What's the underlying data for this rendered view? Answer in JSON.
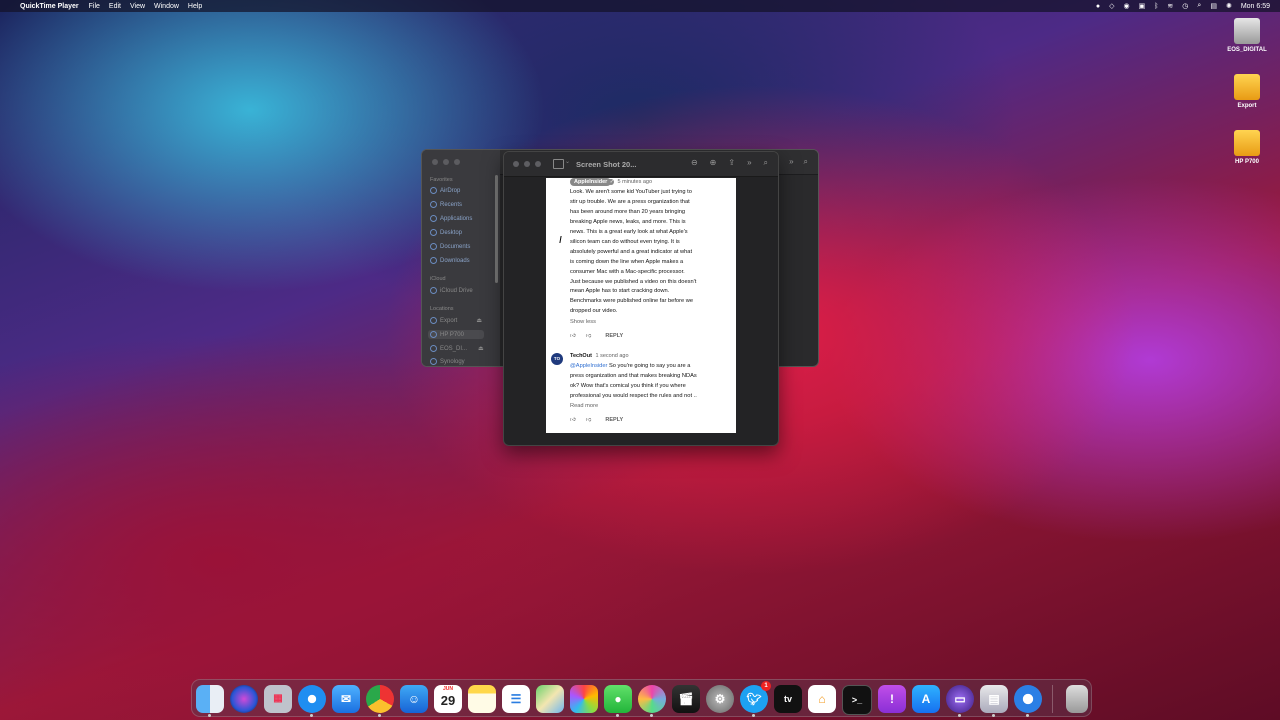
{
  "menubar": {
    "app": "QuickTime Player",
    "items": [
      "File",
      "Edit",
      "View",
      "Window",
      "Help"
    ],
    "clock": "Mon 6:59"
  },
  "desktop_drives": [
    {
      "label": "EOS_DIGITAL",
      "color": "gray"
    },
    {
      "label": "Export",
      "color": "gold"
    },
    {
      "label": "HP P700",
      "color": "gold"
    }
  ],
  "finder": {
    "section_favorites": "Favorites",
    "favorites": [
      "AirDrop",
      "Recents",
      "Applications",
      "Desktop",
      "Documents",
      "Downloads"
    ],
    "section_icloud": "iCloud",
    "icloud": [
      "iCloud Drive"
    ],
    "section_locations": "Locations",
    "locations": [
      "Export",
      "HP P700",
      "EOS_DI...",
      "Synology"
    ]
  },
  "preview": {
    "title": "Screen Shot 20...",
    "comment1": {
      "author": "AppleInsider",
      "time": "5 minutes ago",
      "lines": [
        "Look. We aren't some kid YouTuber just trying to",
        "stir up trouble. We are a press organization that",
        "has been around more than 20 years bringing",
        "breaking Apple news, leaks, and more. This is",
        "news. This is a great early look at what Apple's",
        "silicon team can do without even trying. It is",
        "absolutely powerful and a great indicator at what",
        "is coming down the line when Apple makes a",
        "consumer Mac with a Mac-specific processor.",
        "Just because we published a video on this doesn't",
        "mean Apple has to start cracking down.",
        "Benchmarks were published online far before we",
        "dropped our video."
      ],
      "toggle": "Show less",
      "reply": "REPLY"
    },
    "comment2": {
      "avatar": "TO",
      "author": "TechOut",
      "time": "1 second ago",
      "mention": "@AppleInsider",
      "first_line": " So you're going to say you are a",
      "lines": [
        "press organization and that makes breaking NDAs",
        "ok? Wow that's comical you think if you where",
        "professional you would respect the rules and not .."
      ],
      "toggle": "Read more",
      "reply": "REPLY"
    }
  },
  "dock": {
    "calendar_month": "JUN",
    "calendar_day": "29",
    "twitter_badge": "1",
    "apps": [
      "finder-icon",
      "siri-icon",
      "launchpad-icon",
      "safari-icon",
      "mail-icon",
      "chrome-icon",
      "migration-icon",
      "calendar-icon",
      "notes-icon",
      "reminders-icon",
      "maps-icon",
      "photos-icon",
      "messages-icon",
      "motion-icon",
      "final-cut-icon",
      "settings-icon",
      "twitter-icon",
      "apple-tv-icon",
      "home-icon",
      "terminal-icon",
      "feedback-icon",
      "app-store-icon",
      "disk-icon",
      "preview-icon",
      "quicktime-icon",
      "trash-icon"
    ]
  }
}
